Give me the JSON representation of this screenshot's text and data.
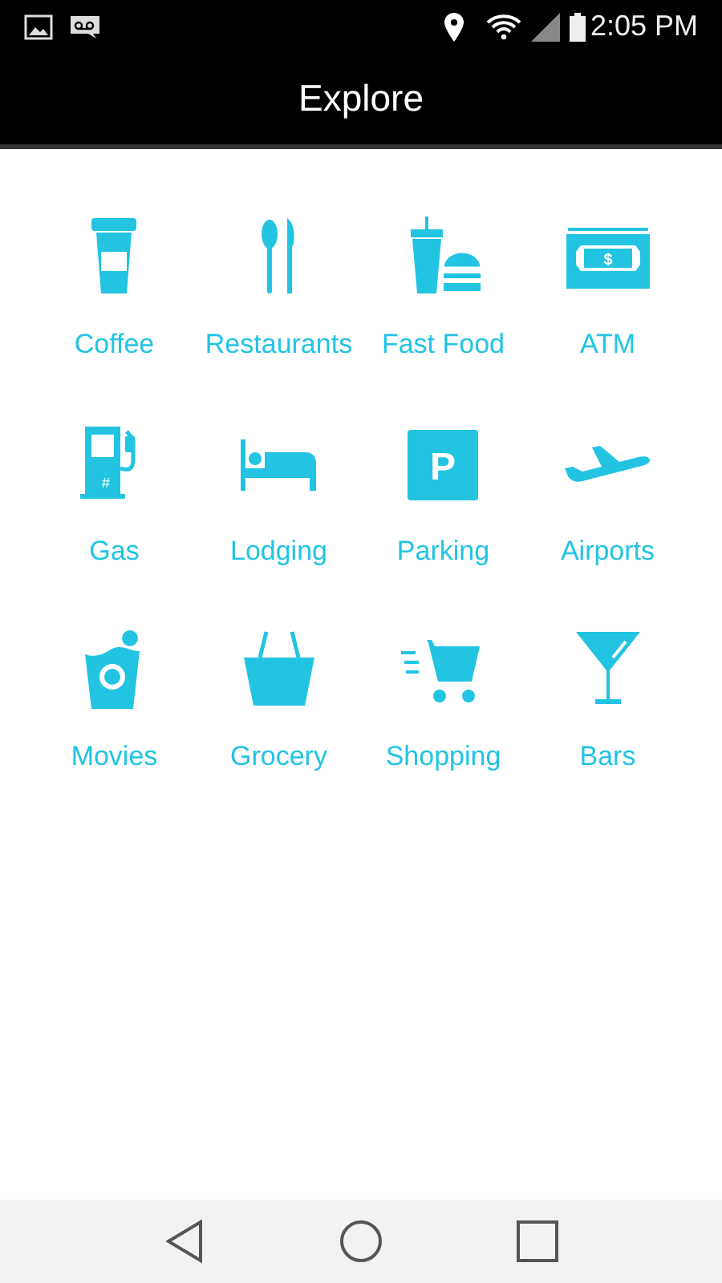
{
  "status_bar": {
    "time": "2:05 PM"
  },
  "title": "Explore",
  "categories": [
    {
      "label": "Coffee",
      "kind": "coffee"
    },
    {
      "label": "Restaurants",
      "kind": "restaurants"
    },
    {
      "label": "Fast Food",
      "kind": "fastfood"
    },
    {
      "label": "ATM",
      "kind": "atm",
      "glyph": "$"
    },
    {
      "label": "Gas",
      "kind": "gas",
      "glyph": "#"
    },
    {
      "label": "Lodging",
      "kind": "lodging"
    },
    {
      "label": "Parking",
      "kind": "parking",
      "glyph": "P"
    },
    {
      "label": "Airports",
      "kind": "airports"
    },
    {
      "label": "Movies",
      "kind": "movies"
    },
    {
      "label": "Grocery",
      "kind": "grocery"
    },
    {
      "label": "Shopping",
      "kind": "shopping"
    },
    {
      "label": "Bars",
      "kind": "bars"
    }
  ]
}
